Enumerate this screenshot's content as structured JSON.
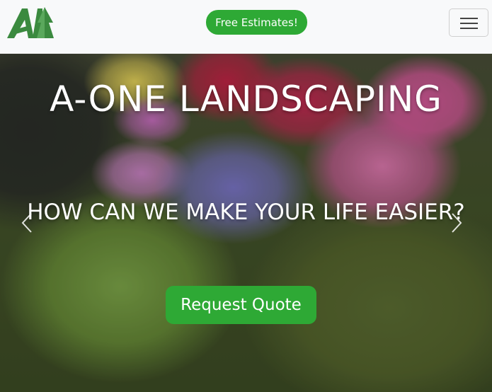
{
  "navbar": {
    "estimate_label": "Free Estimates!",
    "menu_icon": "hamburger-menu-icon",
    "logo_icon": "a-one-tree-logo",
    "brand_color": "#2ea935"
  },
  "hero": {
    "title": "A-ONE LANDSCAPING",
    "subtitle": "HOW CAN WE MAKE YOUR LIFE EASIER?",
    "cta_label": "Request Quote",
    "prev_icon": "chevron-left-icon",
    "next_icon": "chevron-right-icon"
  }
}
